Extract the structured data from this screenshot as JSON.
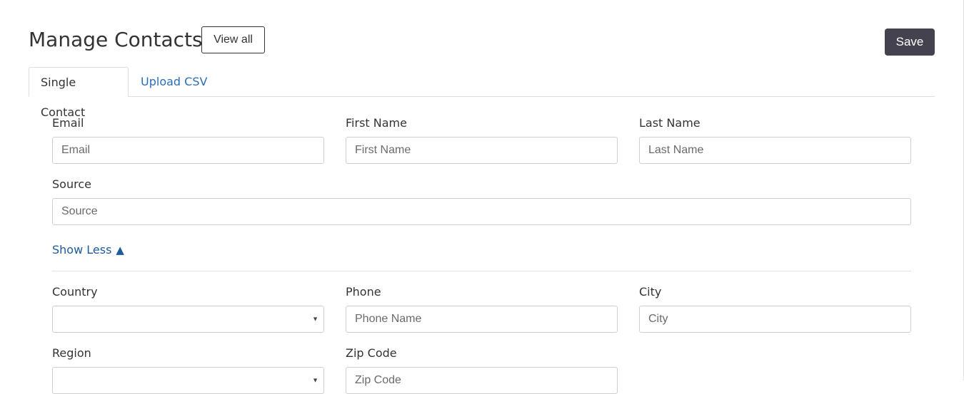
{
  "header": {
    "title": "Manage Contacts",
    "view_all_label": "View all",
    "save_label": "Save"
  },
  "tabs": [
    {
      "label": "Single Contact",
      "active": true
    },
    {
      "label": "Upload CSV",
      "active": false
    }
  ],
  "fields": {
    "email": {
      "label": "Email",
      "placeholder": "Email",
      "value": ""
    },
    "first_name": {
      "label": "First Name",
      "placeholder": "First Name",
      "value": ""
    },
    "last_name": {
      "label": "Last Name",
      "placeholder": "Last Name",
      "value": ""
    },
    "source": {
      "label": "Source",
      "placeholder": "Source",
      "value": ""
    },
    "country": {
      "label": "Country",
      "selected": ""
    },
    "phone": {
      "label": "Phone",
      "placeholder": "Phone Name",
      "value": ""
    },
    "city": {
      "label": "City",
      "placeholder": "City",
      "value": ""
    },
    "region": {
      "label": "Region",
      "selected": ""
    },
    "zip": {
      "label": "Zip Code",
      "placeholder": "Zip Code",
      "value": ""
    }
  },
  "toggle": {
    "label": "Show Less",
    "icon": "triangle-up-icon",
    "glyph": "▲"
  },
  "colors": {
    "save_bg": "#45424f",
    "link": "#2a6ebb",
    "toggle": "#1f5a9a"
  }
}
